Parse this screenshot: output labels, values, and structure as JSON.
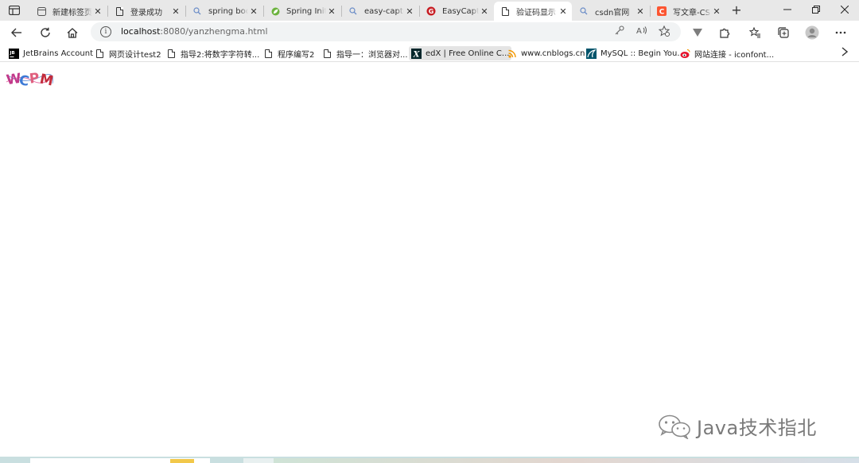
{
  "browser": {
    "tabs": [
      {
        "title": "新建标签页",
        "icon": "newtab-page-icon"
      },
      {
        "title": "登录成功",
        "icon": "page-icon"
      },
      {
        "title": "spring boot",
        "icon": "search-icon"
      },
      {
        "title": "Spring Initializr",
        "icon": "spring-leaf-icon"
      },
      {
        "title": "easy-captcha",
        "icon": "search-icon"
      },
      {
        "title": "EasyCaptcha",
        "icon": "gitee-icon"
      },
      {
        "title": "验证码显示",
        "icon": "page-icon",
        "active": true
      },
      {
        "title": "csdn官网",
        "icon": "search-icon"
      },
      {
        "title": "写文章-CSDN",
        "icon": "csdn-icon"
      }
    ],
    "address": {
      "host": "localhost",
      "path": ":8080/yanzhengma.html"
    },
    "bookmarks": [
      {
        "label": "JetBrains Account",
        "icon": "jetbrains-icon"
      },
      {
        "label": "网页设计test2",
        "icon": "page-icon"
      },
      {
        "label": "指导2:将数字字符转...",
        "icon": "page-icon"
      },
      {
        "label": "程序编写2",
        "icon": "page-icon"
      },
      {
        "label": "指导一：浏览器对...",
        "icon": "page-icon"
      },
      {
        "label": "edX | Free Online C...",
        "icon": "edx-icon"
      },
      {
        "label": "www.cnblogs.cn",
        "icon": "cnblogs-icon"
      },
      {
        "label": "MySQL :: Begin You...",
        "icon": "mysql-icon"
      },
      {
        "label": "网站连接 - iconfont...",
        "icon": "weibo-icon"
      }
    ]
  },
  "page": {
    "captcha_text": [
      "W",
      "C",
      "P",
      "M"
    ],
    "captcha_colors": [
      "#c2398a",
      "#3d7ad6",
      "#e0607e",
      "#c22c3c"
    ]
  },
  "watermark": {
    "text": "Java技术指北",
    "icon": "wechat-icon"
  },
  "colors": {
    "tabstrip_bg": "#e8e8e8",
    "toolbar_bg": "#ffffff",
    "address_bg": "#f1f3f4"
  }
}
